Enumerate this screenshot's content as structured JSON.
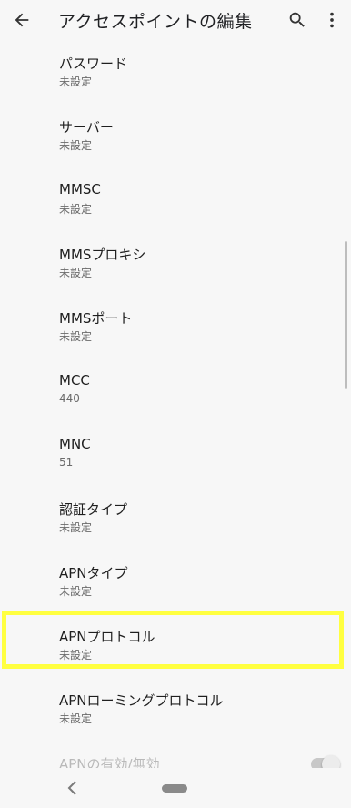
{
  "appbar": {
    "title": "アクセスポイントの編集",
    "back_icon": "arrow-left-icon",
    "search_icon": "search-icon",
    "more_icon": "more-vert-icon"
  },
  "items": [
    {
      "label": "パスワード",
      "value": "未設定"
    },
    {
      "label": "サーバー",
      "value": "未設定"
    },
    {
      "label": "MMSC",
      "value": "未設定"
    },
    {
      "label": "MMSプロキシ",
      "value": "未設定"
    },
    {
      "label": "MMSポート",
      "value": "未設定"
    },
    {
      "label": "MCC",
      "value": "440"
    },
    {
      "label": "MNC",
      "value": "51"
    },
    {
      "label": "認証タイプ",
      "value": "未設定"
    },
    {
      "label": "APNタイプ",
      "value": "未設定"
    },
    {
      "label": "APNプロトコル",
      "value": "未設定"
    },
    {
      "label": "APNローミングプロトコル",
      "value": "未設定"
    },
    {
      "label": "APNの有効/無効"
    }
  ],
  "colors": {
    "highlight": "#ffff40",
    "background": "#f7f7f7"
  },
  "navbar": {
    "back_icon": "chevron-left-icon",
    "home_icon": "home-pill-icon"
  }
}
